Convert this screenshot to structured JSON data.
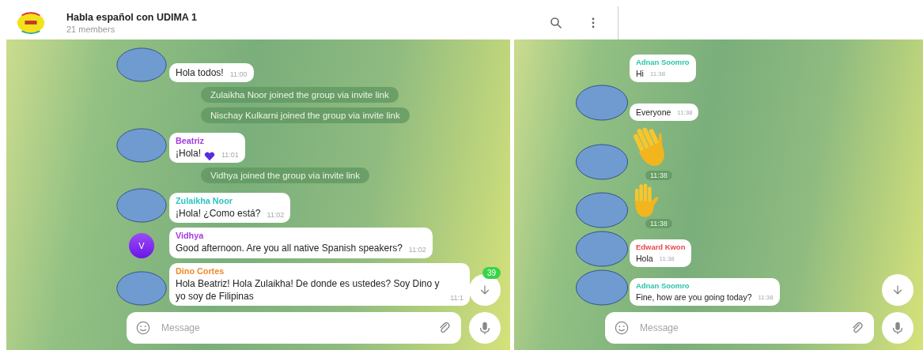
{
  "header": {
    "title": "Habla español con UDIMA 1",
    "subtitle": "21 members"
  },
  "left_chat": {
    "items": [
      {
        "kind": "message",
        "avatar": true,
        "text": "Hola todos!",
        "time": "11:00"
      },
      {
        "kind": "system",
        "text": "Zulaikha Noor joined the group via invite link"
      },
      {
        "kind": "system",
        "text": "Nischay Kulkarni joined the group via invite link"
      },
      {
        "kind": "message",
        "avatar": true,
        "sender": "Beatriz",
        "color": "#a23be0",
        "text": "¡Hola!",
        "heart": true,
        "time": "11:01"
      },
      {
        "kind": "system",
        "text": "Vidhya joined the group via invite link"
      },
      {
        "kind": "message",
        "avatar": true,
        "sender": "Zulaikha Noor",
        "color": "#2cc3c3",
        "text": "¡Hola! ¿Como está?",
        "time": "11:02"
      },
      {
        "kind": "message",
        "avatar_letter": "V",
        "sender": "Vidhya",
        "color": "#a23be0",
        "text": "Good afternoon. Are you all native Spanish speakers?",
        "time": "11:02"
      },
      {
        "kind": "message",
        "avatar": true,
        "sender": "Dino Cortes",
        "color": "#f08a2c",
        "text": "Hola Beatriz! Hola Zulaikha! De donde es ustedes? Soy Dino y yo soy de Filipinas",
        "time": "11:1"
      }
    ],
    "unread_badge": "39",
    "input": {
      "placeholder": "Message"
    }
  },
  "right_chat": {
    "items": [
      {
        "kind": "message",
        "avatar": false,
        "sender": "Adnan Soomro",
        "color": "#2cc3a8",
        "text": "Hi",
        "time": "11:38"
      },
      {
        "kind": "message",
        "avatar": true,
        "text": "Everyone",
        "time": "11:38"
      },
      {
        "kind": "waving_hand_sticker",
        "avatar": true,
        "time": "11:38"
      },
      {
        "kind": "raised_hand_sticker",
        "avatar": true,
        "time": "11:38"
      },
      {
        "kind": "message",
        "avatar": true,
        "sender": "Edward Kwon",
        "color": "#e8484a",
        "text": "Hola",
        "time": "11:38"
      },
      {
        "kind": "message",
        "avatar": true,
        "sender": "Adnan Soomro",
        "color": "#2cc3a8",
        "text": "Fine, how are you going today?",
        "time": "11:38"
      }
    ],
    "input": {
      "placeholder": "Message"
    }
  }
}
